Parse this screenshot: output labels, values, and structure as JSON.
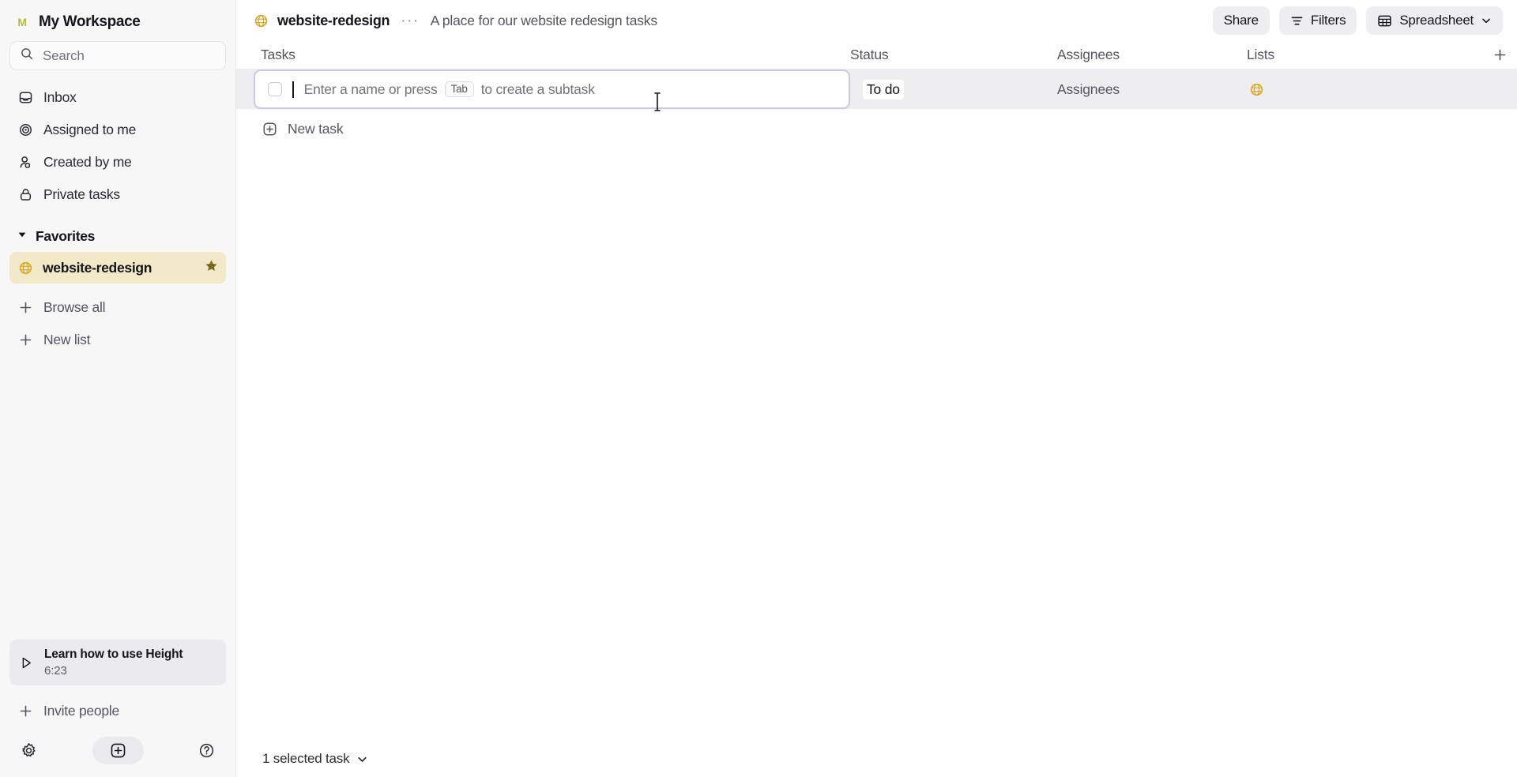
{
  "sidebar": {
    "workspace": {
      "avatar_letter": "M",
      "title": "My Workspace"
    },
    "search": {
      "placeholder": "Search"
    },
    "nav_items": [
      {
        "label": "Inbox",
        "icon": "inbox-icon"
      },
      {
        "label": "Assigned to me",
        "icon": "target-icon"
      },
      {
        "label": "Created by me",
        "icon": "user-icon"
      },
      {
        "label": "Private tasks",
        "icon": "lock-icon"
      }
    ],
    "favorites": {
      "label": "Favorites",
      "expanded": true
    },
    "favorite_items": [
      {
        "label": "website-redesign",
        "icon": "globe-icon",
        "starred": true,
        "highlight_color": "#f1e9c8"
      }
    ],
    "links": [
      {
        "label": "Browse all",
        "icon": "plus-icon"
      },
      {
        "label": "New list",
        "icon": "plus-icon"
      }
    ],
    "promo": {
      "title": "Learn how to use Height",
      "duration": "6:23",
      "icon": "play-icon"
    },
    "invite": {
      "label": "Invite people",
      "icon": "plus-icon"
    },
    "bottom_icons": [
      {
        "name": "gear-icon"
      },
      {
        "name": "plus-square-icon"
      },
      {
        "name": "help-icon"
      }
    ]
  },
  "topbar": {
    "breadcrumb_icon": "globe-icon",
    "breadcrumb_name": "website-redesign",
    "overflow": "···",
    "description": "A place for our website redesign tasks",
    "actions": {
      "share_label": "Share",
      "filters_label": "Filters",
      "view_label": "Spreadsheet"
    }
  },
  "table": {
    "columns": [
      {
        "key": "tasks",
        "label": "Tasks"
      },
      {
        "key": "status",
        "label": "Status"
      },
      {
        "key": "assignees",
        "label": "Assignees"
      },
      {
        "key": "lists",
        "label": "Lists"
      }
    ],
    "add_column_icon": "plus-icon",
    "editing_row": {
      "placeholder_before": "Enter a name or press",
      "keycap": "Tab",
      "placeholder_after": "to create a subtask",
      "status": "To do",
      "assignees": "Assignees",
      "list_icon": "globe-icon"
    },
    "new_task": {
      "label": "New task",
      "icon": "plus-square-icon"
    }
  },
  "statusbar": {
    "text": "1 selected task",
    "chevron": "chevron-down-icon"
  },
  "colors": {
    "accent_gold": "#d8a82a",
    "focus_border": "#cfc7e8",
    "row_highlight": "#eeeef1",
    "favorite_highlight": "#f1e9c8"
  }
}
